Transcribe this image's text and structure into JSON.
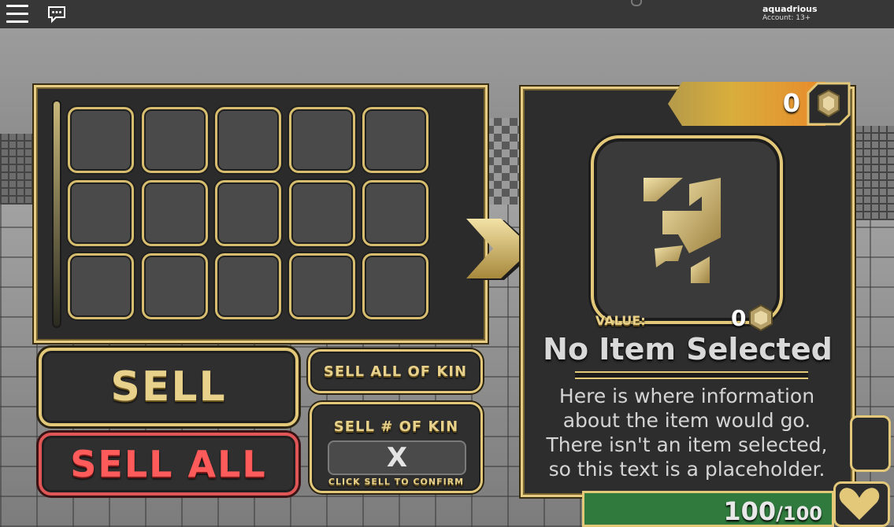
{
  "topbar": {
    "username": "aquadrious",
    "account": "Account: 13+"
  },
  "inventory": {
    "slot_count": 15
  },
  "actions": {
    "sell_label": "SELL",
    "sell_all_label": "SELL ALL",
    "sell_all_of_kin_label": "SELL ALL OF KIN",
    "sell_num_of_kin_title": "SELL # OF KIN",
    "quantity_value": "X",
    "sell_num_hint": "CLICK SELL TO CONFIRM"
  },
  "detail": {
    "currency": "0",
    "value_label": "VALUE:",
    "value_amount": "0",
    "title": "No Item Selected",
    "description": "Here is where information about the item would go. There isn't an item selected, so this text is a placeholder."
  },
  "health": {
    "current": "100",
    "max": "/100"
  },
  "colors": {
    "gold": "#e2c878",
    "panel": "#2d2d2d",
    "danger": "#e05555",
    "health": "#2f7a3c"
  },
  "icons": [
    "menu-icon",
    "chat-icon",
    "arrow-right-icon",
    "coin-icon",
    "item-rune-icon",
    "heart-icon"
  ]
}
